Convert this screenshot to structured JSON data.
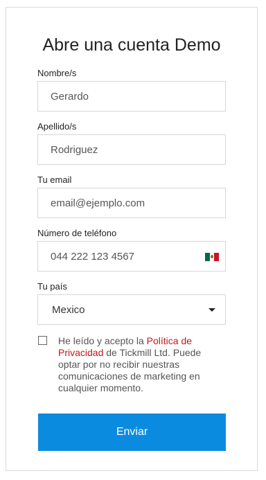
{
  "form": {
    "title": "Abre una cuenta Demo",
    "first_name": {
      "label": "Nombre/s",
      "placeholder": "Gerardo"
    },
    "last_name": {
      "label": "Apellido/s",
      "placeholder": "Rodriguez"
    },
    "email": {
      "label": "Tu email",
      "placeholder": "email@ejemplo.com"
    },
    "phone": {
      "label": "Número de teléfono",
      "placeholder": "044 222 123 4567",
      "flag_icon": "mexico-flag-icon"
    },
    "country": {
      "label": "Tu país",
      "selected": "Mexico"
    },
    "consent": {
      "text_before": "He leído y acepto la ",
      "link_text": "Política de Privacidad",
      "text_after": " de Tickmill Ltd. Puede optar por no recibir nuestras comunicaciones de marketing en cualquier momento.",
      "checked": false
    },
    "submit_label": "Enviar"
  },
  "colors": {
    "accent": "#0b8be0",
    "link": "#c01818"
  }
}
